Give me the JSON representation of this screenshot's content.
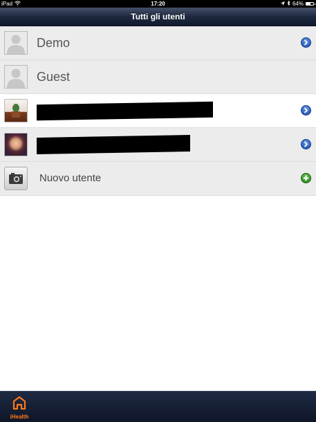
{
  "status_bar": {
    "device": "iPad",
    "time": "17:20",
    "battery_text": "64%",
    "battery_level": 0.64
  },
  "nav": {
    "title": "Tutti gli utenti"
  },
  "users": [
    {
      "name": "Demo",
      "avatar": "person-placeholder-icon",
      "accessory": "disclosure-arrow-icon"
    },
    {
      "name": "Guest",
      "avatar": "person-placeholder-icon",
      "accessory": ""
    },
    {
      "name": "",
      "avatar": "user-photo-plant",
      "accessory": "disclosure-arrow-icon",
      "redacted": true
    },
    {
      "name": "",
      "avatar": "user-photo-face",
      "accessory": "disclosure-arrow-icon",
      "redacted": true
    }
  ],
  "new_user": {
    "label": "Nuovo utente",
    "icon": "camera-icon",
    "accessory": "add-icon"
  },
  "tab_bar": {
    "ihealth_label": "iHealth"
  },
  "colors": {
    "nav_bar": "#1e2940",
    "tab_bar": "#0e1628",
    "tab_accent": "#ff7a1a",
    "disclosure": "#2f66c8",
    "add": "#3c9a2a",
    "row_gray": "#ececec",
    "row_white": "#ffffff"
  }
}
